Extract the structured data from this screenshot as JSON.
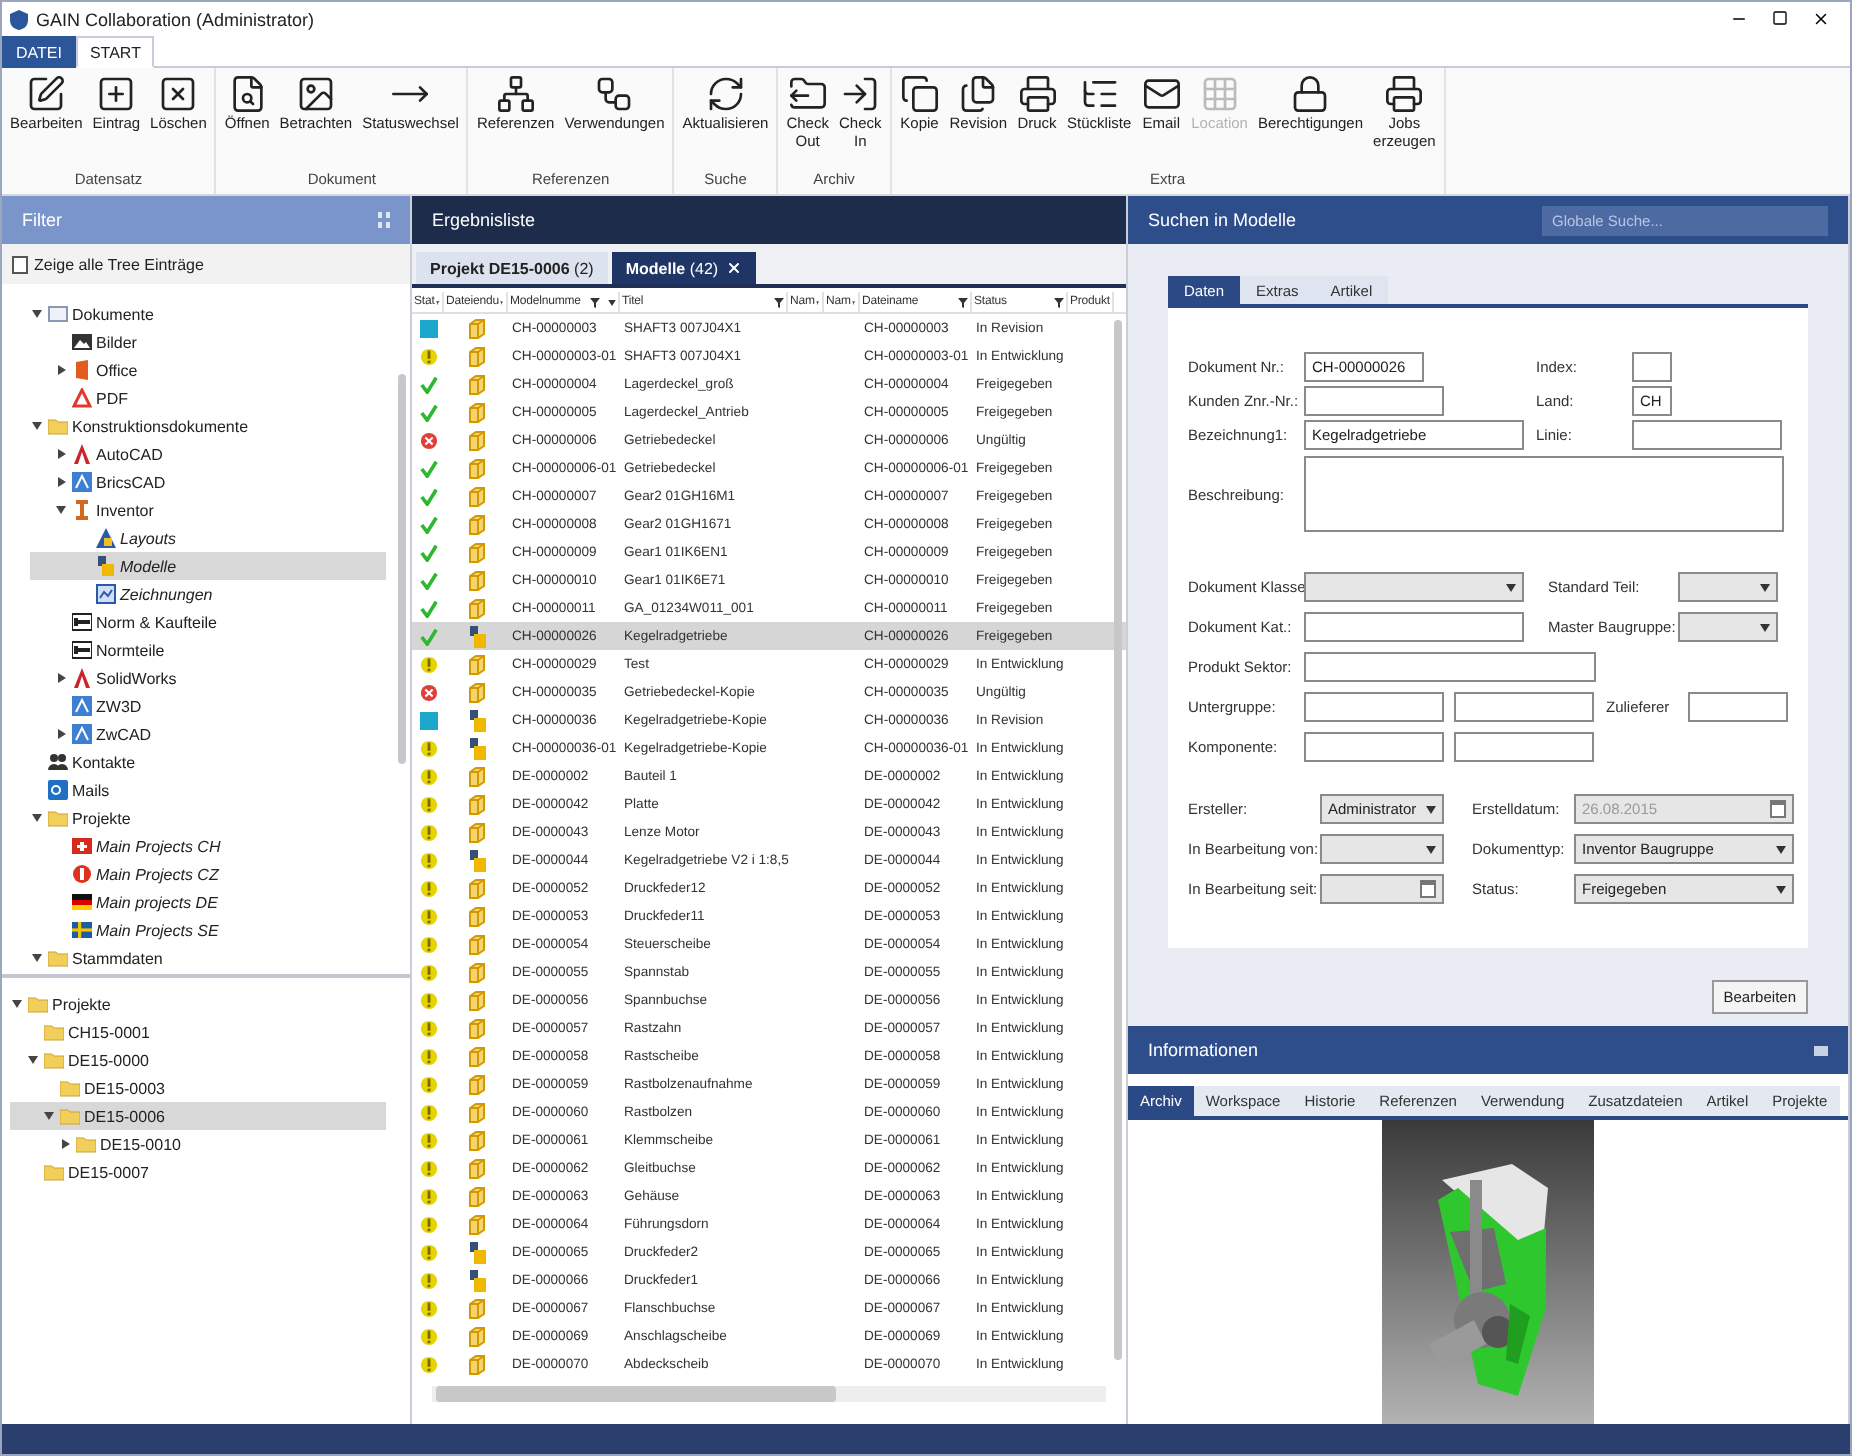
{
  "window": {
    "title": "GAIN Collaboration (Administrator)"
  },
  "ribbon_tabs": [
    {
      "label": "DATEI",
      "kind": "file",
      "selected": false
    },
    {
      "label": "START",
      "kind": "tab",
      "selected": true
    }
  ],
  "ribbon_groups": [
    {
      "label": "Datensatz",
      "buttons": [
        {
          "label": "Bearbeiten",
          "kind": "edit",
          "disabled": false
        },
        {
          "label": "Eintrag",
          "kind": "add",
          "disabled": false
        },
        {
          "label": "Löschen",
          "kind": "delete",
          "disabled": false
        }
      ]
    },
    {
      "label": "Dokument",
      "buttons": [
        {
          "label": "Öffnen",
          "kind": "open",
          "disabled": false
        },
        {
          "label": "Betrachten",
          "kind": "view",
          "disabled": false
        },
        {
          "label": "Statuswechsel",
          "kind": "status",
          "disabled": false
        }
      ]
    },
    {
      "label": "Referenzen",
      "buttons": [
        {
          "label": "Referenzen",
          "kind": "refs",
          "disabled": false
        },
        {
          "label": "Verwendungen",
          "kind": "uses",
          "disabled": false
        }
      ]
    },
    {
      "label": "Suche",
      "buttons": [
        {
          "label": "Aktualisieren",
          "kind": "refresh",
          "disabled": false
        }
      ]
    },
    {
      "label": "Archiv",
      "buttons": [
        {
          "label": "Check Out",
          "kind": "checkout",
          "disabled": false
        },
        {
          "label": "Check In",
          "kind": "checkin",
          "disabled": false
        }
      ]
    },
    {
      "label": "Extra",
      "buttons": [
        {
          "label": "Kopie",
          "kind": "copy",
          "disabled": false
        },
        {
          "label": "Revision",
          "kind": "revision",
          "disabled": false
        },
        {
          "label": "Druck",
          "kind": "print",
          "disabled": false
        },
        {
          "label": "Stückliste",
          "kind": "bom",
          "disabled": false
        },
        {
          "label": "Email",
          "kind": "mail",
          "disabled": false
        },
        {
          "label": "Location",
          "kind": "location",
          "disabled": true
        },
        {
          "label": "Berechtigungen",
          "kind": "permissions",
          "disabled": false
        },
        {
          "label": "Jobs erzeugen",
          "kind": "jobs",
          "disabled": false
        }
      ]
    }
  ],
  "filter": {
    "title": "Filter",
    "show_all": {
      "label": "Zeige alle Tree Einträge",
      "checked": false
    },
    "tree": [
      {
        "label": "Dokumente",
        "kind": "document",
        "expanded": true,
        "selected": false,
        "italic": false,
        "children": [
          {
            "label": "Bilder",
            "kind": "picture",
            "selected": false,
            "italic": false
          },
          {
            "label": "Office",
            "kind": "office",
            "expanded": false,
            "selected": false,
            "italic": false
          },
          {
            "label": "PDF",
            "kind": "pdf",
            "selected": false,
            "italic": false
          }
        ]
      },
      {
        "label": "Konstruktionsdokumente",
        "kind": "folder",
        "expanded": true,
        "selected": false,
        "italic": false,
        "children": [
          {
            "label": "AutoCAD",
            "kind": "app_red",
            "expanded": false,
            "selected": false,
            "italic": false
          },
          {
            "label": "BricsCAD",
            "kind": "app_blue",
            "expanded": false,
            "selected": false,
            "italic": false
          },
          {
            "label": "Inventor",
            "kind": "app_orange",
            "expanded": true,
            "selected": false,
            "italic": false,
            "children": [
              {
                "label": "Layouts",
                "kind": "part_blue",
                "selected": false,
                "italic": true
              },
              {
                "label": "Modelle",
                "kind": "assembly",
                "selected": true,
                "italic": true
              },
              {
                "label": "Zeichnungen",
                "kind": "drawing",
                "selected": false,
                "italic": true
              }
            ]
          },
          {
            "label": "Norm & Kaufteile",
            "kind": "norm",
            "selected": false,
            "italic": false
          },
          {
            "label": "Normteile",
            "kind": "norm",
            "selected": false,
            "italic": false
          },
          {
            "label": "SolidWorks",
            "kind": "app_red",
            "expanded": false,
            "selected": false,
            "italic": false
          },
          {
            "label": "ZW3D",
            "kind": "app_blue",
            "selected": false,
            "italic": false
          },
          {
            "label": "ZwCAD",
            "kind": "app_blue",
            "expanded": false,
            "selected": false,
            "italic": false
          }
        ]
      },
      {
        "label": "Kontakte",
        "kind": "contacts",
        "selected": false,
        "italic": false
      },
      {
        "label": "Mails",
        "kind": "mail",
        "selected": false,
        "italic": false
      },
      {
        "label": "Projekte",
        "kind": "folder",
        "expanded": true,
        "selected": false,
        "italic": false,
        "children": [
          {
            "label": "Main Projects CH",
            "kind": "flag_ch",
            "selected": false,
            "italic": true
          },
          {
            "label": "Main Projects CZ",
            "kind": "stop",
            "selected": false,
            "italic": true
          },
          {
            "label": "Main projects DE",
            "kind": "flag_de",
            "selected": false,
            "italic": true
          },
          {
            "label": "Main Projects SE",
            "kind": "flag_se",
            "selected": false,
            "italic": true
          }
        ]
      },
      {
        "label": "Stammdaten",
        "kind": "folder",
        "expanded": true,
        "selected": false,
        "italic": false
      }
    ],
    "projects": [
      {
        "label": "Projekte",
        "kind": "folder",
        "expanded": true,
        "selected": false,
        "italic": false,
        "children": [
          {
            "label": "CH15-0001",
            "kind": "folder",
            "selected": false,
            "italic": false
          },
          {
            "label": "DE15-0000",
            "kind": "folder",
            "expanded": true,
            "selected": false,
            "italic": false,
            "children": [
              {
                "label": "DE15-0003",
                "kind": "folder",
                "selected": false,
                "italic": false
              },
              {
                "label": "DE15-0006",
                "kind": "folder",
                "expanded": true,
                "selected": true,
                "italic": false,
                "children": [
                  {
                    "label": "DE15-0010",
                    "kind": "folder",
                    "expanded": false,
                    "selected": false,
                    "italic": false
                  }
                ]
              }
            ]
          },
          {
            "label": "DE15-0007",
            "kind": "folder",
            "selected": false,
            "italic": false
          }
        ]
      }
    ]
  },
  "results": {
    "title": "Ergebnisliste",
    "tabs": [
      {
        "label": "**Projekt DE15-0006** (2)",
        "selected": false,
        "closable": false
      },
      {
        "label": "**Modelle** (42)",
        "selected": true,
        "closable": true
      }
    ],
    "columns": [
      {
        "label": "Stat",
        "filter": true,
        "sorted": false
      },
      {
        "label": "Dateiendu",
        "filter": true,
        "sorted": false
      },
      {
        "label": "Modelnumme",
        "filter": true,
        "sorted": true
      },
      {
        "label": "Titel",
        "filter": true,
        "sorted": false
      },
      {
        "label": "Nam",
        "filter": true,
        "sorted": false
      },
      {
        "label": "Nam",
        "filter": true,
        "sorted": false
      },
      {
        "label": "Dateiname",
        "filter": true,
        "sorted": false
      },
      {
        "label": "Status",
        "filter": true,
        "sorted": false
      },
      {
        "label": "Produkt"
      }
    ],
    "rows": [
      {
        "status_icon": {
          "kind": "revision"
        },
        "file_icon": {
          "kind": "part"
        },
        "number": "CH-00000003",
        "title": "SHAFT3 007J04X1",
        "file": "CH-00000003",
        "status": "In Revision",
        "selected": false
      },
      {
        "status_icon": {
          "kind": "development"
        },
        "file_icon": {
          "kind": "part"
        },
        "number": "CH-00000003-01",
        "title": "SHAFT3 007J04X1",
        "file": "CH-00000003-01",
        "status": "In Entwicklung",
        "selected": false
      },
      {
        "status_icon": {
          "kind": "released"
        },
        "file_icon": {
          "kind": "part"
        },
        "number": "CH-00000004",
        "title": "Lagerdeckel_groß",
        "file": "CH-00000004",
        "status": "Freigegeben",
        "selected": false
      },
      {
        "status_icon": {
          "kind": "released"
        },
        "file_icon": {
          "kind": "part"
        },
        "number": "CH-00000005",
        "title": "Lagerdeckel_Antrieb",
        "file": "CH-00000005",
        "status": "Freigegeben",
        "selected": false
      },
      {
        "status_icon": {
          "kind": "invalid"
        },
        "file_icon": {
          "kind": "part"
        },
        "number": "CH-00000006",
        "title": "Getriebedeckel",
        "file": "CH-00000006",
        "status": "Ungültig",
        "selected": false
      },
      {
        "status_icon": {
          "kind": "released"
        },
        "file_icon": {
          "kind": "part"
        },
        "number": "CH-00000006-01",
        "title": "Getriebedeckel",
        "file": "CH-00000006-01",
        "status": "Freigegeben",
        "selected": false
      },
      {
        "status_icon": {
          "kind": "released"
        },
        "file_icon": {
          "kind": "part"
        },
        "number": "CH-00000007",
        "title": "Gear2 01GH16M1",
        "file": "CH-00000007",
        "status": "Freigegeben",
        "selected": false
      },
      {
        "status_icon": {
          "kind": "released"
        },
        "file_icon": {
          "kind": "part"
        },
        "number": "CH-00000008",
        "title": "Gear2 01GH1671",
        "file": "CH-00000008",
        "status": "Freigegeben",
        "selected": false
      },
      {
        "status_icon": {
          "kind": "released"
        },
        "file_icon": {
          "kind": "part"
        },
        "number": "CH-00000009",
        "title": "Gear1 01IK6EN1",
        "file": "CH-00000009",
        "status": "Freigegeben",
        "selected": false
      },
      {
        "status_icon": {
          "kind": "released"
        },
        "file_icon": {
          "kind": "part"
        },
        "number": "CH-00000010",
        "title": "Gear1 01IK6E71",
        "file": "CH-00000010",
        "status": "Freigegeben",
        "selected": false
      },
      {
        "status_icon": {
          "kind": "released"
        },
        "file_icon": {
          "kind": "part"
        },
        "number": "CH-00000011",
        "title": "GA_01234W011_001",
        "file": "CH-00000011",
        "status": "Freigegeben",
        "selected": false
      },
      {
        "status_icon": {
          "kind": "released"
        },
        "file_icon": {
          "kind": "assembly"
        },
        "number": "CH-00000026",
        "title": "Kegelradgetriebe",
        "file": "CH-00000026",
        "status": "Freigegeben",
        "selected": true
      },
      {
        "status_icon": {
          "kind": "development"
        },
        "file_icon": {
          "kind": "part"
        },
        "number": "CH-00000029",
        "title": "Test",
        "file": "CH-00000029",
        "status": "In Entwicklung",
        "selected": false
      },
      {
        "status_icon": {
          "kind": "invalid"
        },
        "file_icon": {
          "kind": "part"
        },
        "number": "CH-00000035",
        "title": "Getriebedeckel-Kopie",
        "file": "CH-00000035",
        "status": "Ungültig",
        "selected": false
      },
      {
        "status_icon": {
          "kind": "revision"
        },
        "file_icon": {
          "kind": "assembly"
        },
        "number": "CH-00000036",
        "title": "Kegelradgetriebe-Kopie",
        "file": "CH-00000036",
        "status": "In Revision",
        "selected": false
      },
      {
        "status_icon": {
          "kind": "development"
        },
        "file_icon": {
          "kind": "assembly"
        },
        "number": "CH-00000036-01",
        "title": "Kegelradgetriebe-Kopie",
        "file": "CH-00000036-01",
        "status": "In Entwicklung",
        "selected": false
      },
      {
        "status_icon": {
          "kind": "development"
        },
        "file_icon": {
          "kind": "part"
        },
        "number": "DE-0000002",
        "title": "Bauteil 1",
        "file": "DE-0000002",
        "status": "In Entwicklung",
        "selected": false
      },
      {
        "status_icon": {
          "kind": "development"
        },
        "file_icon": {
          "kind": "part"
        },
        "number": "DE-0000042",
        "title": "Platte",
        "file": "DE-0000042",
        "status": "In Entwicklung",
        "selected": false
      },
      {
        "status_icon": {
          "kind": "development"
        },
        "file_icon": {
          "kind": "part"
        },
        "number": "DE-0000043",
        "title": "Lenze Motor",
        "file": "DE-0000043",
        "status": "In Entwicklung",
        "selected": false
      },
      {
        "status_icon": {
          "kind": "development"
        },
        "file_icon": {
          "kind": "assembly"
        },
        "number": "DE-0000044",
        "title": "Kegelradgetriebe V2 i 1:8,5",
        "file": "DE-0000044",
        "status": "In Entwicklung",
        "selected": false
      },
      {
        "status_icon": {
          "kind": "development"
        },
        "file_icon": {
          "kind": "part"
        },
        "number": "DE-0000052",
        "title": "Druckfeder12",
        "file": "DE-0000052",
        "status": "In Entwicklung",
        "selected": false
      },
      {
        "status_icon": {
          "kind": "development"
        },
        "file_icon": {
          "kind": "part"
        },
        "number": "DE-0000053",
        "title": "Druckfeder11",
        "file": "DE-0000053",
        "status": "In Entwicklung",
        "selected": false
      },
      {
        "status_icon": {
          "kind": "development"
        },
        "file_icon": {
          "kind": "part"
        },
        "number": "DE-0000054",
        "title": "Steuerscheibe",
        "file": "DE-0000054",
        "status": "In Entwicklung",
        "selected": false
      },
      {
        "status_icon": {
          "kind": "development"
        },
        "file_icon": {
          "kind": "part"
        },
        "number": "DE-0000055",
        "title": "Spannstab",
        "file": "DE-0000055",
        "status": "In Entwicklung",
        "selected": false
      },
      {
        "status_icon": {
          "kind": "development"
        },
        "file_icon": {
          "kind": "part"
        },
        "number": "DE-0000056",
        "title": "Spannbuchse",
        "file": "DE-0000056",
        "status": "In Entwicklung",
        "selected": false
      },
      {
        "status_icon": {
          "kind": "development"
        },
        "file_icon": {
          "kind": "part"
        },
        "number": "DE-0000057",
        "title": "Rastzahn",
        "file": "DE-0000057",
        "status": "In Entwicklung",
        "selected": false
      },
      {
        "status_icon": {
          "kind": "development"
        },
        "file_icon": {
          "kind": "part"
        },
        "number": "DE-0000058",
        "title": "Rastscheibe",
        "file": "DE-0000058",
        "status": "In Entwicklung",
        "selected": false
      },
      {
        "status_icon": {
          "kind": "development"
        },
        "file_icon": {
          "kind": "part"
        },
        "number": "DE-0000059",
        "title": "Rastbolzenaufnahme",
        "file": "DE-0000059",
        "status": "In Entwicklung",
        "selected": false
      },
      {
        "status_icon": {
          "kind": "development"
        },
        "file_icon": {
          "kind": "part"
        },
        "number": "DE-0000060",
        "title": "Rastbolzen",
        "file": "DE-0000060",
        "status": "In Entwicklung",
        "selected": false
      },
      {
        "status_icon": {
          "kind": "development"
        },
        "file_icon": {
          "kind": "part"
        },
        "number": "DE-0000061",
        "title": "Klemmscheibe",
        "file": "DE-0000061",
        "status": "In Entwicklung",
        "selected": false
      },
      {
        "status_icon": {
          "kind": "development"
        },
        "file_icon": {
          "kind": "part"
        },
        "number": "DE-0000062",
        "title": "Gleitbuchse",
        "file": "DE-0000062",
        "status": "In Entwicklung",
        "selected": false
      },
      {
        "status_icon": {
          "kind": "development"
        },
        "file_icon": {
          "kind": "part"
        },
        "number": "DE-0000063",
        "title": "Gehäuse",
        "file": "DE-0000063",
        "status": "In Entwicklung",
        "selected": false
      },
      {
        "status_icon": {
          "kind": "development"
        },
        "file_icon": {
          "kind": "part"
        },
        "number": "DE-0000064",
        "title": "Führungsdorn",
        "file": "DE-0000064",
        "status": "In Entwicklung",
        "selected": false
      },
      {
        "status_icon": {
          "kind": "development"
        },
        "file_icon": {
          "kind": "assembly"
        },
        "number": "DE-0000065",
        "title": "Druckfeder2",
        "file": "DE-0000065",
        "status": "In Entwicklung",
        "selected": false
      },
      {
        "status_icon": {
          "kind": "development"
        },
        "file_icon": {
          "kind": "assembly"
        },
        "number": "DE-0000066",
        "title": "Druckfeder1",
        "file": "DE-0000066",
        "status": "In Entwicklung",
        "selected": false
      },
      {
        "status_icon": {
          "kind": "development"
        },
        "file_icon": {
          "kind": "part"
        },
        "number": "DE-0000067",
        "title": "Flanschbuchse",
        "file": "DE-0000067",
        "status": "In Entwicklung",
        "selected": false
      },
      {
        "status_icon": {
          "kind": "development"
        },
        "file_icon": {
          "kind": "part"
        },
        "number": "DE-0000069",
        "title": "Anschlagscheibe",
        "file": "DE-0000069",
        "status": "In Entwicklung",
        "selected": false
      },
      {
        "status_icon": {
          "kind": "development"
        },
        "file_icon": {
          "kind": "part"
        },
        "number": "DE-0000070",
        "title": "Abdeckscheib",
        "file": "DE-0000070",
        "status": "In Entwicklung",
        "selected": false
      }
    ]
  },
  "search": {
    "title": "Suchen in Modelle",
    "global_search": {
      "placeholder": "Globale Suche..."
    },
    "tabs": [
      {
        "label": "Daten",
        "selected": true
      },
      {
        "label": "Extras",
        "selected": false
      },
      {
        "label": "Artikel",
        "selected": false
      }
    ],
    "rows": [
      {
        "items": [
          {
            "kind": "label",
            "text": "Dokument Nr.:"
          },
          {
            "kind": "text",
            "value": "CH-00000026"
          },
          {
            "kind": "label",
            "text": "Index:"
          },
          {
            "kind": "text"
          }
        ]
      },
      {
        "items": [
          {
            "kind": "label",
            "text": "Kunden Znr.-Nr.:"
          },
          {
            "kind": "text"
          },
          {
            "kind": "label",
            "text": "Land:"
          },
          {
            "kind": "text",
            "value": "CH"
          }
        ]
      },
      {
        "items": [
          {
            "kind": "label",
            "text": "Bezeichnung1:"
          },
          {
            "kind": "text",
            "value": "Kegelradgetriebe"
          },
          {
            "kind": "label",
            "text": "Linie:"
          },
          {
            "kind": "text"
          }
        ]
      },
      {
        "items": [
          {
            "kind": "label",
            "text": "Beschreibung:"
          },
          {
            "kind": "area"
          }
        ]
      },
      {
        "items": [
          {
            "kind": "label",
            "text": "Dokument Klasse"
          },
          {
            "kind": "select"
          },
          {
            "kind": "label",
            "text": "Standard Teil:"
          },
          {
            "kind": "select"
          }
        ]
      },
      {
        "items": [
          {
            "kind": "label",
            "text": "Dokument Kat.:"
          },
          {
            "kind": "text"
          },
          {
            "kind": "label",
            "text": "Master Baugruppe:"
          },
          {
            "kind": "select"
          }
        ]
      },
      {
        "items": [
          {
            "kind": "label",
            "text": "Produkt Sektor:"
          },
          {
            "kind": "text"
          }
        ]
      },
      {
        "items": [
          {
            "kind": "label",
            "text": "Untergruppe:"
          },
          {
            "kind": "text"
          },
          {
            "kind": "text"
          },
          {
            "kind": "label",
            "text": "Zulieferer"
          },
          {
            "kind": "text"
          }
        ]
      },
      {
        "items": [
          {
            "kind": "label",
            "text": "Komponente:"
          },
          {
            "kind": "text"
          },
          {
            "kind": "text"
          }
        ]
      },
      {
        "items": [
          {
            "kind": "label",
            "text": "Ersteller:"
          },
          {
            "kind": "select",
            "value": "Administrator"
          },
          {
            "kind": "label",
            "text": "Erstelldatum:"
          },
          {
            "kind": "date",
            "value": "26.08.2015",
            "disabled": true
          }
        ]
      },
      {
        "items": [
          {
            "kind": "label",
            "text": "In Bearbeitung von:"
          },
          {
            "kind": "select"
          },
          {
            "kind": "label",
            "text": "Dokumenttyp:"
          },
          {
            "kind": "select",
            "value": "Inventor Baugruppe"
          }
        ]
      },
      {
        "items": [
          {
            "kind": "label",
            "text": "In Bearbeitung seit:"
          },
          {
            "kind": "date",
            "disabled": true
          },
          {
            "kind": "label",
            "text": "Status:"
          },
          {
            "kind": "select",
            "value": "Freigegeben"
          }
        ]
      }
    ],
    "edit_button": "Bearbeiten"
  },
  "info": {
    "title": "Informationen",
    "tabs": [
      {
        "label": "Archiv",
        "selected": true
      },
      {
        "label": "Workspace",
        "selected": false
      },
      {
        "label": "Historie",
        "selected": false
      },
      {
        "label": "Referenzen",
        "selected": false
      },
      {
        "label": "Verwendung",
        "selected": false
      },
      {
        "label": "Zusatzdateien",
        "selected": false
      },
      {
        "label": "Artikel",
        "selected": false
      },
      {
        "label": "Projekte",
        "selected": false
      }
    ]
  }
}
